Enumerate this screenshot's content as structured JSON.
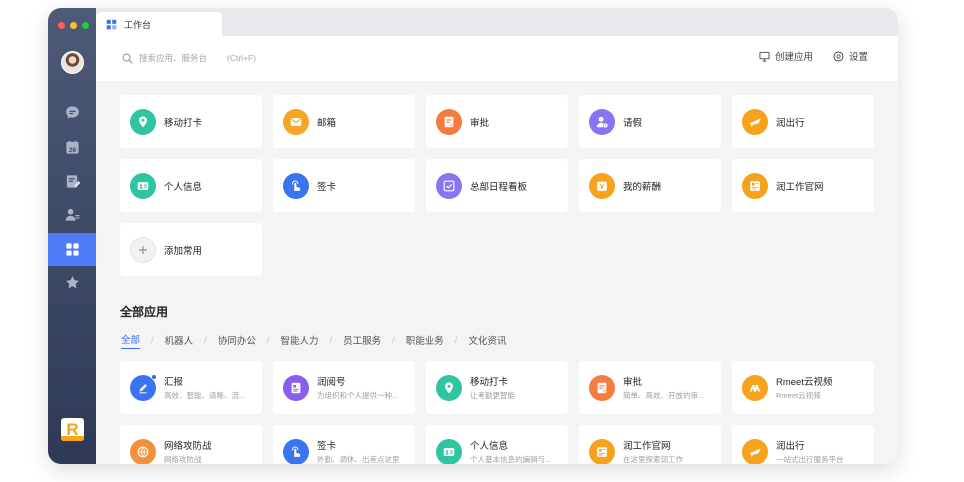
{
  "window": {
    "tab_title": "工作台",
    "traffic_lights": [
      "#ff5f57",
      "#febc2e",
      "#28c840"
    ]
  },
  "sidebar": {
    "items": [
      {
        "name": "chat",
        "icon": "chat-bubble-icon"
      },
      {
        "name": "calendar",
        "icon": "calendar-icon",
        "label": "26"
      },
      {
        "name": "docs",
        "icon": "document-edit-icon"
      },
      {
        "name": "contacts",
        "icon": "contacts-icon"
      },
      {
        "name": "workbench",
        "icon": "grid-icon",
        "active": true
      },
      {
        "name": "favorites",
        "icon": "star-icon"
      }
    ],
    "brand_letter": "R"
  },
  "topbar": {
    "search_placeholder": "搜索应用、服务台",
    "search_shortcut": "(Ctrl+F)",
    "create_label": "创建应用",
    "settings_label": "设置"
  },
  "frequent": [
    {
      "label": "移动打卡",
      "color": "#2ec5a0",
      "icon": "location-pin-icon"
    },
    {
      "label": "邮箱",
      "color": "#f5a524",
      "icon": "mail-icon"
    },
    {
      "label": "审批",
      "color": "#f57b3f",
      "icon": "approval-doc-icon"
    },
    {
      "label": "请假",
      "color": "#8b74f0",
      "icon": "leave-person-icon"
    },
    {
      "label": "润出行",
      "color": "#f6a21c",
      "icon": "plane-icon"
    },
    {
      "label": "个人信息",
      "color": "#2ec5a0",
      "icon": "id-card-icon"
    },
    {
      "label": "签卡",
      "color": "#3b74f0",
      "icon": "tap-hand-icon"
    },
    {
      "label": "总部日程看板",
      "color": "#8b74f0",
      "icon": "calendar-check-icon"
    },
    {
      "label": "我的薪酬",
      "color": "#f6a21c",
      "icon": "wallet-icon"
    },
    {
      "label": "润工作官网",
      "color": "#f6a21c",
      "icon": "website-icon"
    },
    {
      "label": "添加常用",
      "color": "#f1f2f4",
      "icon": "plus-icon"
    }
  ],
  "all_apps": {
    "title": "全部应用",
    "filters": [
      "全部",
      "机器人",
      "协同办公",
      "智能人力",
      "员工服务",
      "职能业务",
      "文化资讯"
    ],
    "active_filter": "全部",
    "apps": [
      {
        "name": "汇报",
        "desc": "高效、智能、清晰、流...",
        "color": "#3b74f0",
        "icon": "pen-icon"
      },
      {
        "name": "润阅号",
        "desc": "为组织和个人提供一种...",
        "color": "#8b5cf0",
        "icon": "article-icon"
      },
      {
        "name": "移动打卡",
        "desc": "让考勤更智能",
        "color": "#2ec5a0",
        "icon": "location-pin-icon"
      },
      {
        "name": "审批",
        "desc": "简单、高效、开放的审...",
        "color": "#f57b3f",
        "icon": "approval-doc-icon"
      },
      {
        "name": "Rmeet云视频",
        "desc": "Rmeet云视频",
        "color": "#f6a21c",
        "icon": "video-meeting-icon"
      },
      {
        "name": "网络攻防战",
        "desc": "网络攻防战",
        "color": "#f2913c",
        "icon": "globe-shield-icon"
      },
      {
        "name": "签卡",
        "desc": "外勤、调休、出差点这里",
        "color": "#3b74f0",
        "icon": "tap-hand-icon"
      },
      {
        "name": "个人信息",
        "desc": "个人基本信息的编辑与...",
        "color": "#2ec5a0",
        "icon": "id-card-icon"
      },
      {
        "name": "润工作官网",
        "desc": "在这里探索润工作",
        "color": "#f6a21c",
        "icon": "website-icon"
      },
      {
        "name": "润出行",
        "desc": "一站式出行服务平台",
        "color": "#f6a21c",
        "icon": "plane-icon"
      }
    ]
  }
}
